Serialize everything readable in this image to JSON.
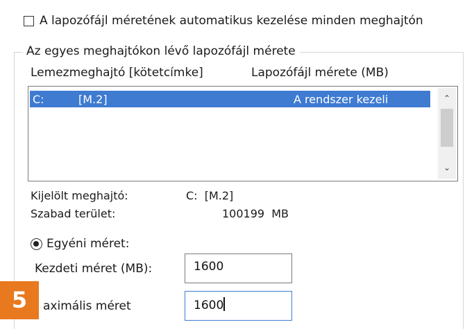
{
  "auto_manage": {
    "label": "A lapozófájl méretének automatikus kezelése minden meghajtón",
    "checked": false
  },
  "group": {
    "title": "Az egyes meghajtókon lévő lapozófájl mérete",
    "col_drive": "Lemezmeghajtó [kötetcímke]",
    "col_size": "Lapozófájl mérete (MB)",
    "rows": [
      {
        "drive": "C:",
        "label": "[M.2]",
        "size": "A rendszer kezeli",
        "selected": true
      }
    ]
  },
  "selected_drive": {
    "label": "Kijelölt meghajtó:",
    "value": "C:  [M.2]"
  },
  "free_space": {
    "label": "Szabad terület:",
    "value": "100199  MB"
  },
  "custom_size": {
    "label": "Egyéni méret:",
    "selected": true
  },
  "initial_size": {
    "label": "Kezdeti méret (MB):",
    "value": "1600"
  },
  "max_size": {
    "label": "aximális méret",
    "value": "1600"
  },
  "step_badge": "5",
  "colors": {
    "selection": "#3e7bd1",
    "badge": "#e8791f"
  },
  "icons": {
    "scroll_up": "chevron-up-icon",
    "scroll_down": "chevron-down-icon"
  }
}
